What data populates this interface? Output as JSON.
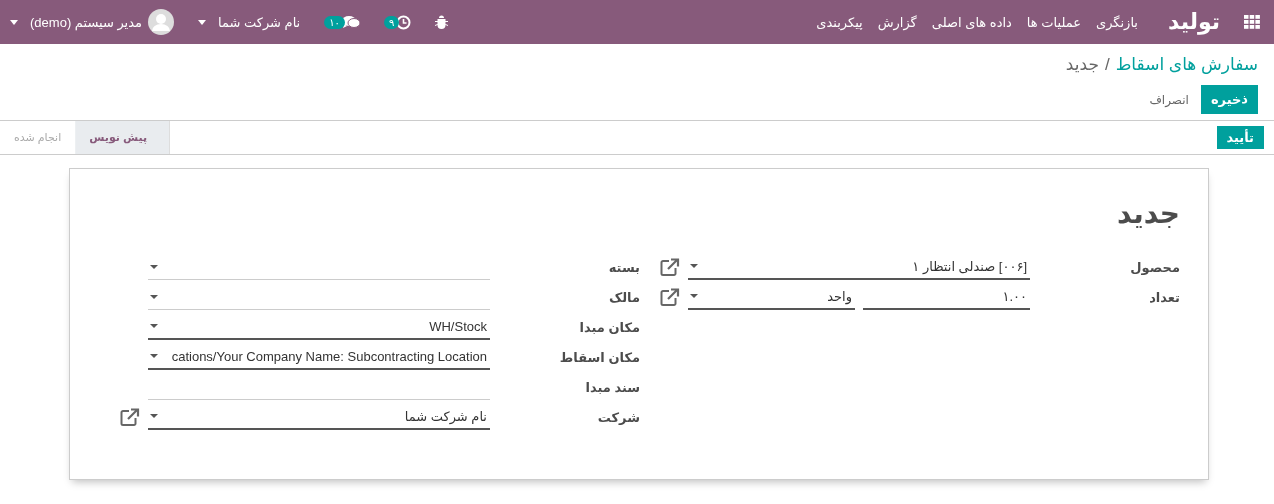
{
  "navbar": {
    "app_name": "تولید",
    "menu": [
      "بازنگری",
      "عملیات ها",
      "داده های اصلی",
      "گزارش",
      "پیکربندی"
    ],
    "activity_badge": "۹",
    "messages_badge": "۱۰",
    "company": "نام شرکت شما",
    "user": "مدیر سیستم (demo)"
  },
  "breadcrumb": {
    "parent": "سفارش های اسقاط",
    "separator": "/",
    "current": "جدید"
  },
  "buttons": {
    "save": "ذخیره",
    "discard": "انصراف",
    "confirm": "تأیید"
  },
  "stages": [
    {
      "label": "پیش نویس",
      "selected": true
    },
    {
      "label": "انجام شده",
      "selected": false
    }
  ],
  "form": {
    "title": "جدید",
    "right_fields": [
      {
        "label": "محصول",
        "kind": "select",
        "value": "[۰۰۶] صندلی انتظار ۱",
        "required": true,
        "link": true
      },
      {
        "label": "تعداد",
        "kind": "quantity",
        "value": "۱.۰۰",
        "unit": "واحد",
        "required": true,
        "link": true
      }
    ],
    "left_fields": [
      {
        "label": "بسته",
        "kind": "select",
        "required": false,
        "link": false
      },
      {
        "label": "مالک",
        "kind": "select",
        "required": false,
        "link": false
      },
      {
        "label": "مکان مبدا",
        "kind": "select",
        "value": "WH/Stock",
        "required": true,
        "link": false
      },
      {
        "label": "مکان اسقاط",
        "kind": "select",
        "value": "cations/Your Company Name: Subcontracting Location",
        "required": true,
        "link": false
      },
      {
        "label": "سند مبدا",
        "kind": "text",
        "required": false,
        "link": false
      },
      {
        "label": "شرکت",
        "kind": "select",
        "value": "نام شرکت شما",
        "required": true,
        "link": true
      }
    ]
  }
}
